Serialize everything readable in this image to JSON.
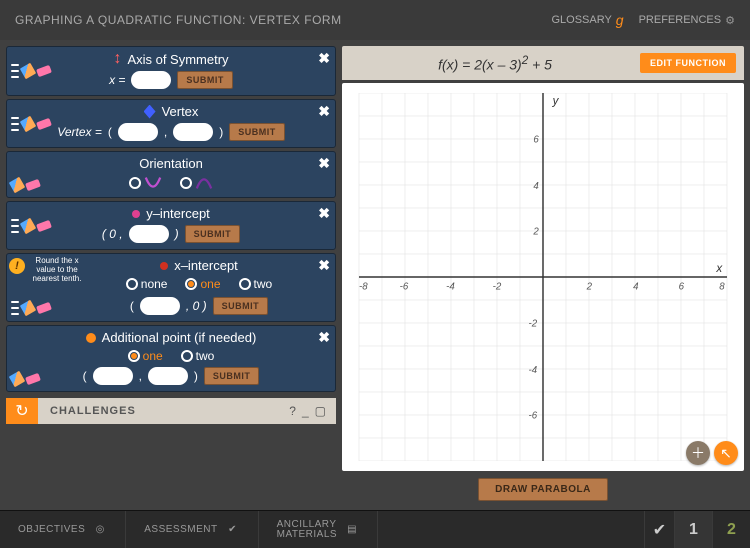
{
  "header": {
    "title": "GRAPHING A QUADRATIC FUNCTION: VERTEX FORM",
    "glossary": "GLOSSARY",
    "preferences": "PREFERENCES"
  },
  "cards": {
    "symmetry": {
      "title": "Axis of Symmetry",
      "label": "x =",
      "submit": "SUBMIT"
    },
    "vertex": {
      "title": "Vertex",
      "label": "Vertex  =",
      "submit": "SUBMIT"
    },
    "orientation": {
      "title": "Orientation"
    },
    "yint": {
      "title": "y–intercept",
      "prefix": "( 0 ,",
      "suffix": ")",
      "submit": "SUBMIT"
    },
    "xint": {
      "title": "x–intercept",
      "warn_text": "Round the x value to the nearest tenth.",
      "options": {
        "none": "none",
        "one": "one",
        "two": "two"
      },
      "suffix": ", 0 )",
      "submit": "SUBMIT"
    },
    "additional": {
      "title": "Additional point (if needed)",
      "options": {
        "one": "one",
        "two": "two"
      },
      "submit": "SUBMIT"
    }
  },
  "challenges": {
    "label": "CHALLENGES"
  },
  "function": {
    "prefix": "f(x) = 2(x – 3)",
    "exp": "2",
    "suffix": " + 5",
    "edit": "EDIT FUNCTION"
  },
  "graph": {
    "xlabel": "x",
    "ylabel": "y",
    "xticks": [
      "-8",
      "-6",
      "-4",
      "-2",
      "2",
      "4",
      "6",
      "8"
    ],
    "yticks": [
      "-6",
      "-4",
      "-2",
      "2",
      "4",
      "6"
    ]
  },
  "draw": {
    "label": "DRAW PARABOLA"
  },
  "footer": {
    "objectives": "OBJECTIVES",
    "assessment": "ASSESSMENT",
    "ancillary": "ANCILLARY\nMATERIALS",
    "page1": "1",
    "page2": "2"
  }
}
